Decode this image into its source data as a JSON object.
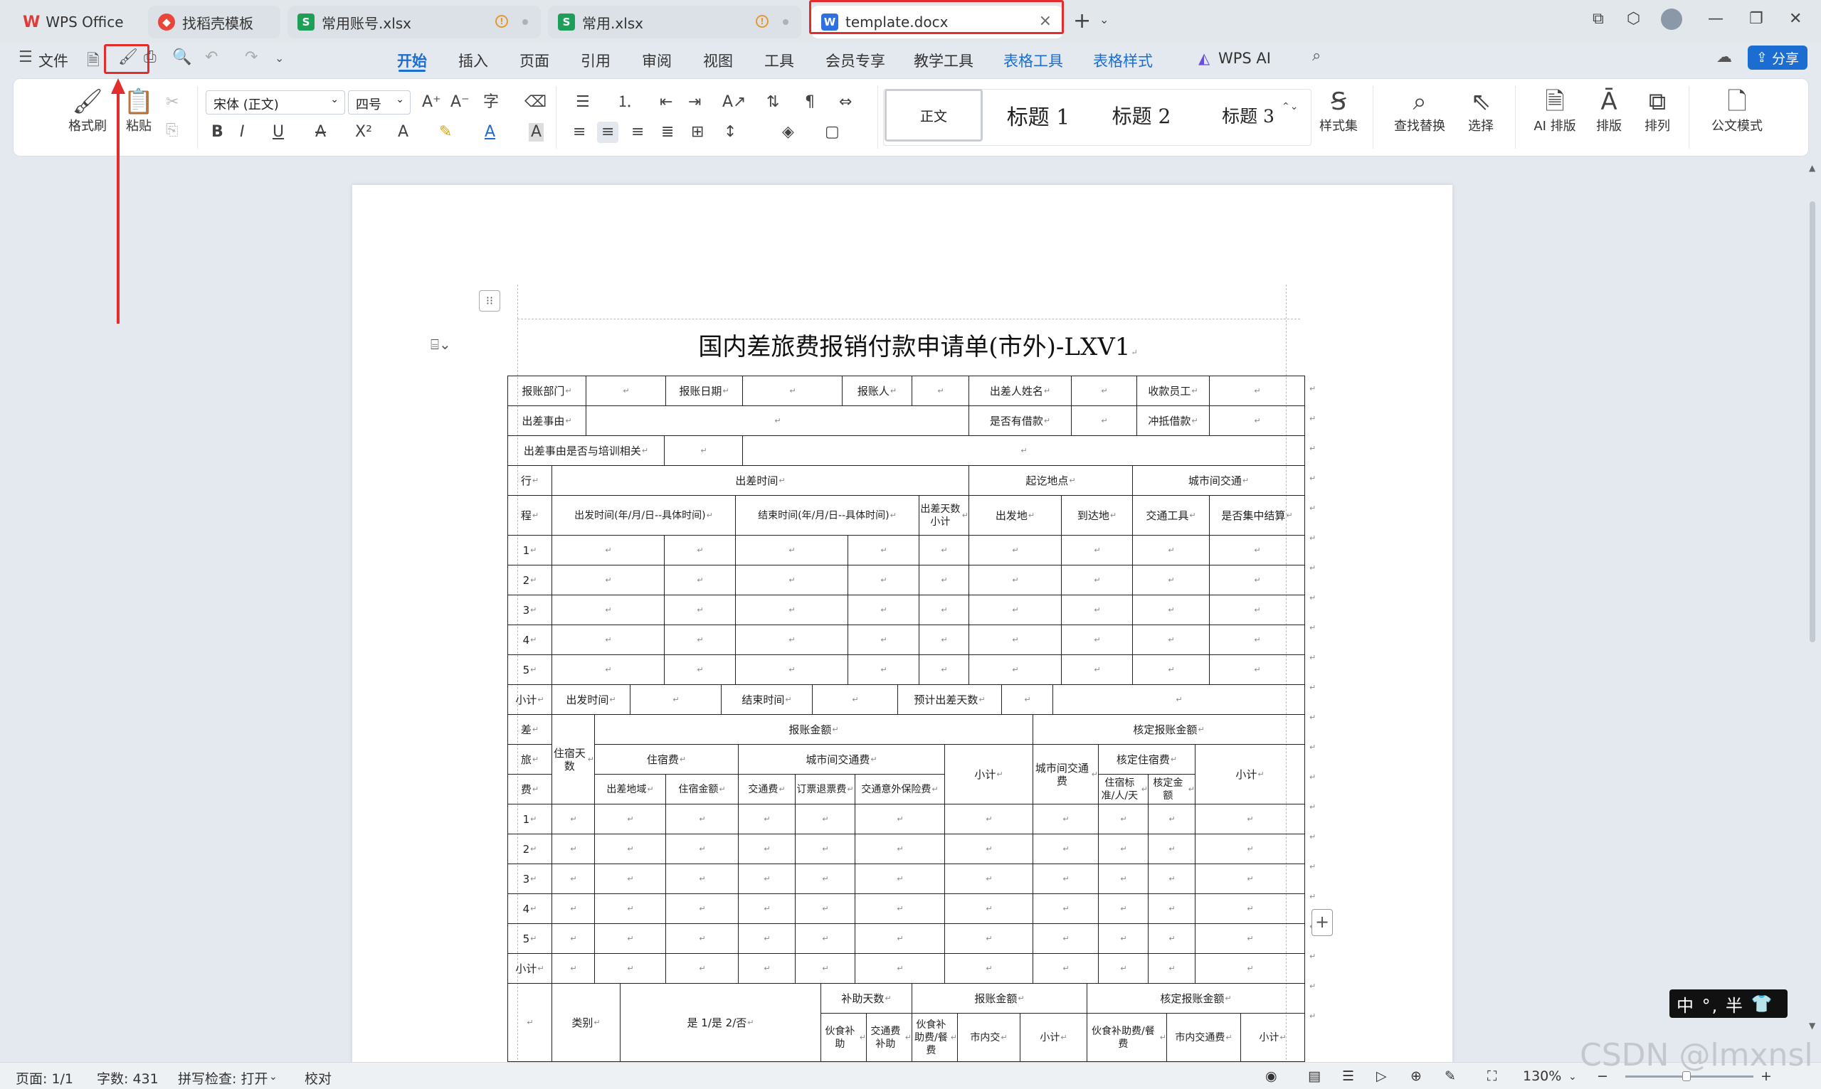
{
  "tabs": [
    {
      "label": "WPS Office",
      "icon": "wps-logo-icon",
      "active": false
    },
    {
      "label": "找稻壳模板",
      "icon": "docer-icon",
      "active": false
    },
    {
      "label": "常用账号.xlsx",
      "icon": "spreadsheet-icon",
      "active": false
    },
    {
      "label": "常用.xlsx",
      "icon": "spreadsheet-icon",
      "active": false
    },
    {
      "label": "template.docx",
      "icon": "word-doc-icon",
      "active": true
    }
  ],
  "menu": {
    "file_label": "文件",
    "tabs": [
      "开始",
      "插入",
      "页面",
      "引用",
      "审阅",
      "视图",
      "工具",
      "会员专享",
      "教学工具",
      "表格工具",
      "表格样式"
    ],
    "wps_ai": "WPS AI",
    "share": "分享"
  },
  "ribbon": {
    "format_painter": "格式刷",
    "paste": "粘贴",
    "font_name": "宋体 (正文)",
    "font_size": "四号",
    "styles": [
      "正文",
      "标题 1",
      "标题 2",
      "标题 3"
    ],
    "style_set": "样式集",
    "find_replace": "查找替换",
    "select": "选择",
    "ai_layout": "AI 排版",
    "layout": "排版",
    "arrange": "排列",
    "official_mode": "公文模式"
  },
  "document": {
    "title": "国内差旅费报销付款申请单(市外)-LXV1",
    "row1": [
      "报账部门",
      "报账日期",
      "报账人",
      "出差人姓名",
      "收款员工"
    ],
    "row2": [
      "出差事由",
      "是否有借款",
      "冲抵借款"
    ],
    "row3": [
      "出差事由是否与培训相关"
    ],
    "trip_header": {
      "trip": "行",
      "cheng": "程",
      "time": "出差时间",
      "place": "起讫地点",
      "intercity": "城市间交通",
      "depart": "出发时间(年/月/日--具体时间)",
      "end": "结束时间(年/月/日--具体时间)",
      "days": "出差天数小计",
      "from": "出发地",
      "to": "到达地",
      "vehicle": "交通工具",
      "centralized": "是否集中结算"
    },
    "row_numbers": [
      "1",
      "2",
      "3",
      "4",
      "5"
    ],
    "subtotal_row": {
      "label": "小计",
      "depart": "出发时间",
      "end": "结束时间",
      "expected_days": "预计出差天数"
    },
    "expense": {
      "cha": "差",
      "lv": "旅",
      "fei": "费",
      "lodging_days": "住宿天数",
      "claim_amount": "报账金额",
      "approved_amount": "核定报账金额",
      "lodging": "住宿费",
      "city_transport": "城市间交通费",
      "subtotal": "小计",
      "intercity_transport": "城市间交通费",
      "approved_lodging": "核定住宿费",
      "location": "出差地域",
      "lodging_amount": "住宿金额",
      "transport_fee": "交通费",
      "refund_fee": "订票退票费",
      "insurance": "交通意外保险费",
      "standard": "住宿标准/人/天",
      "approved": "核定金额"
    },
    "subsidy": {
      "category": "类别",
      "yes_no": "是 1/是 2/否",
      "subsidy_days": "补助天数",
      "claim_amount": "报账金额",
      "approved_amount": "核定报账金额",
      "meal": "伙食补助",
      "transport_sub": "交通费补助",
      "meal_fee": "伙食补助费/餐费",
      "city_transport": "市内交",
      "subtotal": "小计",
      "meal_sub": "伙食补助费/餐费",
      "city_transport_fee": "市内交通费"
    }
  },
  "status": {
    "page": "页面: 1/1",
    "words": "字数: 431",
    "spell": "拼写检查: 打开",
    "proofread": "校对",
    "zoom": "130%"
  },
  "ime": "中 °, 半",
  "watermark": "CSDN @lmxnsl"
}
